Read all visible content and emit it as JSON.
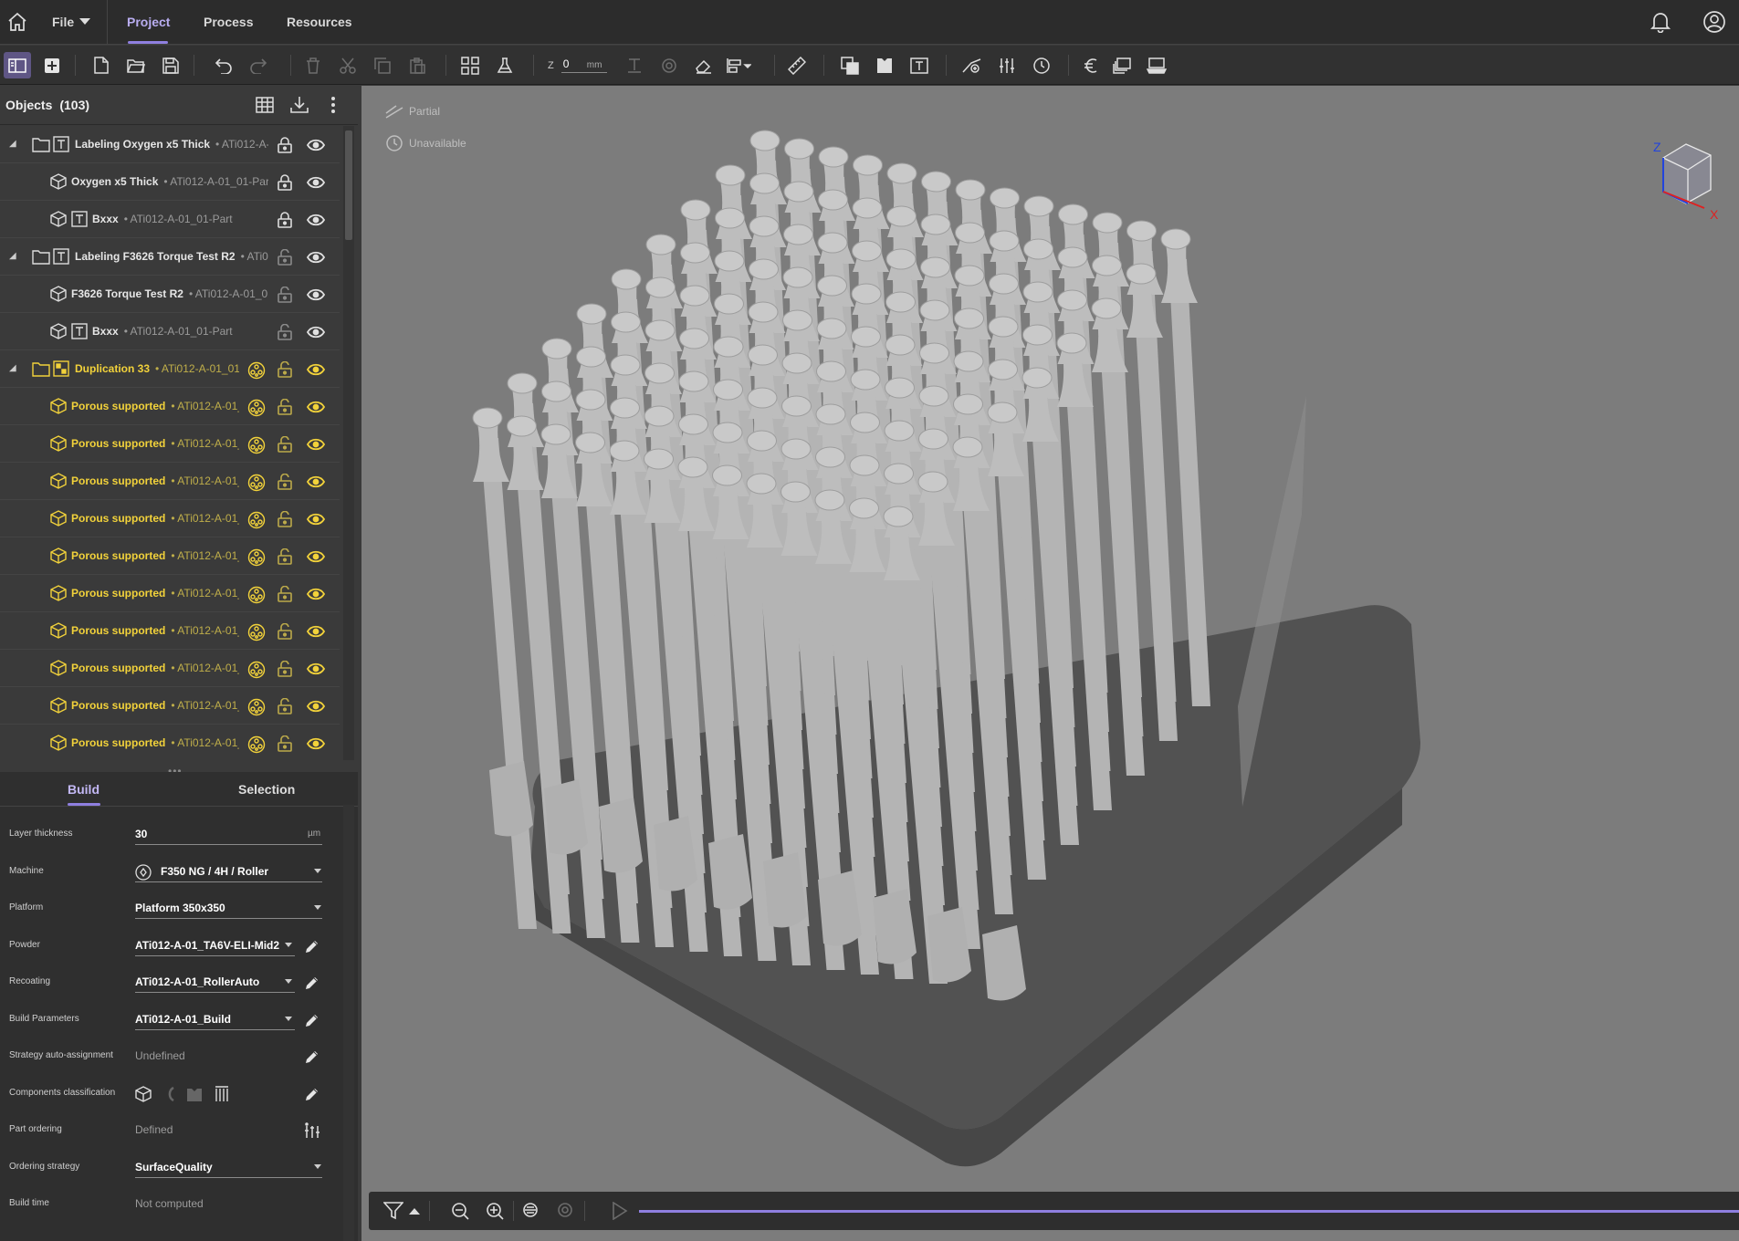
{
  "topbar": {
    "file_label": "File",
    "tabs": [
      {
        "label": "Project",
        "active": true
      },
      {
        "label": "Process",
        "active": false
      },
      {
        "label": "Resources",
        "active": false
      }
    ],
    "accent_color": "#8f7fe0"
  },
  "toolbar": {
    "z_label": "Z",
    "z_value": "0",
    "z_unit": "mm",
    "icons": [
      "panel-toggle-icon",
      "add-icon",
      "new-file-icon",
      "open-folder-icon",
      "save-icon",
      "undo-icon",
      "redo-icon",
      "delete-icon",
      "cut-icon",
      "copy-icon",
      "paste-icon",
      "arrange-icon",
      "flask-icon",
      "support-icon",
      "target-icon",
      "eraser-icon",
      "align-icon",
      "ruler-icon",
      "duplicate-icon",
      "label-icon",
      "text-icon",
      "path-icon",
      "ordering-icon",
      "clock-icon",
      "euro-icon",
      "layers-icon",
      "platform-icon"
    ]
  },
  "objects": {
    "title": "Objects",
    "count": "(103)",
    "rows": [
      {
        "name": "Labeling Oxygen x5 Thick",
        "sub": "ATi012-A-(",
        "kind": "label-group",
        "expandable": true,
        "locked": true,
        "style": "normal"
      },
      {
        "name": "Oxygen x5 Thick",
        "sub": "ATi012-A-01_01-Par",
        "kind": "part",
        "locked": true,
        "style": "normal"
      },
      {
        "name": "Bxxx",
        "sub": "ATi012-A-01_01-Part",
        "kind": "text-part",
        "locked": true,
        "style": "normal"
      },
      {
        "name": "Labeling F3626 Torque Test R2",
        "sub": "ATi0'",
        "kind": "label-group",
        "expandable": true,
        "locked": false,
        "style": "normal"
      },
      {
        "name": "F3626 Torque Test R2",
        "sub": "ATi012-A-01_0",
        "kind": "part",
        "locked": false,
        "style": "normal"
      },
      {
        "name": "Bxxx",
        "sub": "ATi012-A-01_01-Part",
        "kind": "text-part",
        "locked": false,
        "style": "normal"
      },
      {
        "name": "Duplication 33",
        "sub": "ATi012-A-01_01",
        "kind": "dup-group",
        "expandable": true,
        "locked": false,
        "style": "yellow"
      },
      {
        "name": "Porous supported",
        "sub": "ATi012-A-01_",
        "kind": "part",
        "locked": false,
        "style": "yellow"
      },
      {
        "name": "Porous supported",
        "sub": "ATi012-A-01_",
        "kind": "part",
        "locked": false,
        "style": "yellow"
      },
      {
        "name": "Porous supported",
        "sub": "ATi012-A-01_",
        "kind": "part",
        "locked": false,
        "style": "yellow"
      },
      {
        "name": "Porous supported",
        "sub": "ATi012-A-01_",
        "kind": "part",
        "locked": false,
        "style": "yellow"
      },
      {
        "name": "Porous supported",
        "sub": "ATi012-A-01_",
        "kind": "part",
        "locked": false,
        "style": "yellow"
      },
      {
        "name": "Porous supported",
        "sub": "ATi012-A-01_",
        "kind": "part",
        "locked": false,
        "style": "yellow"
      },
      {
        "name": "Porous supported",
        "sub": "ATi012-A-01_",
        "kind": "part",
        "locked": false,
        "style": "yellow"
      },
      {
        "name": "Porous supported",
        "sub": "ATi012-A-01_",
        "kind": "part",
        "locked": false,
        "style": "yellow"
      },
      {
        "name": "Porous supported",
        "sub": "ATi012-A-01_",
        "kind": "part",
        "locked": false,
        "style": "yellow"
      },
      {
        "name": "Porous supported",
        "sub": "ATi012-A-01_",
        "kind": "part",
        "locked": false,
        "style": "yellow"
      }
    ],
    "yellow_color": "#f2d23a"
  },
  "properties": {
    "tabs": [
      {
        "label": "Build",
        "active": true
      },
      {
        "label": "Selection",
        "active": false
      }
    ],
    "rows": [
      {
        "label": "Layer thickness",
        "value": "30",
        "unit": "µm",
        "kind": "input"
      },
      {
        "label": "Machine",
        "value": "F350 NG / 4H / Roller",
        "kind": "select",
        "icon": true
      },
      {
        "label": "Platform",
        "value": "Platform 350x350",
        "kind": "select"
      },
      {
        "label": "Powder",
        "value": "ATi012-A-01_TA6V-ELI-Mid2",
        "kind": "select-edit"
      },
      {
        "label": "Recoating",
        "value": "ATi012-A-01_RollerAuto",
        "kind": "select-edit"
      },
      {
        "label": "Build Parameters",
        "value": "ATi012-A-01_Build",
        "kind": "select-edit"
      },
      {
        "label": "Strategy auto-assignment",
        "value": "Undefined",
        "kind": "text-edit"
      },
      {
        "label": "Components classification",
        "value": "",
        "kind": "icons-edit"
      },
      {
        "label": "Part ordering",
        "value": "Defined",
        "kind": "text-order"
      },
      {
        "label": "Ordering strategy",
        "value": "SurfaceQuality",
        "kind": "select"
      },
      {
        "label": "Build time",
        "value": "Not computed",
        "kind": "text"
      }
    ]
  },
  "viewport": {
    "legend_partial": "Partial",
    "legend_unavailable": "Unavailable",
    "axis_z": "Z",
    "axis_x": "X",
    "background": "#7c7c7c"
  }
}
